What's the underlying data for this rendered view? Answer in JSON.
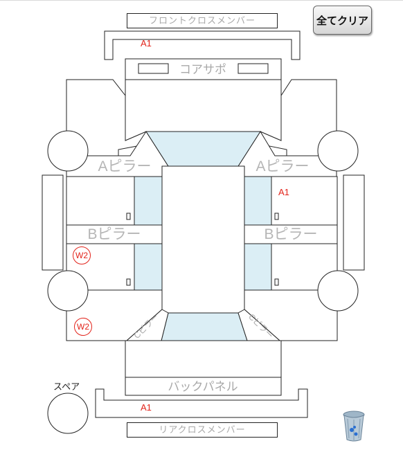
{
  "toolbar": {
    "clear_all_label": "全てクリア"
  },
  "parts": {
    "front_cross_member": "フロントクロスメンバー",
    "core_support": "コアサポ",
    "a_pillar_left": "Aピラー",
    "a_pillar_right": "Aピラー",
    "b_pillar_left": "Bピラー",
    "b_pillar_right": "Bピラー",
    "back_panel": "バックパネル",
    "rear_cross_member": "リアクロスメンバー",
    "c_pillar_left": "Cピラー",
    "c_pillar_right": "Cピラー",
    "spare": "スペア"
  },
  "marks": {
    "front_cross_member": "A1",
    "right_a_pillar_area": "A1",
    "left_rear_door": "W2",
    "left_rear_fender": "W2",
    "rear_cross_member": "A1"
  },
  "icons": {
    "trash": "trash-icon"
  },
  "colors": {
    "glass": "#dbeef5",
    "mark": "#e2231a",
    "label_gray": "#a8a8a8"
  }
}
